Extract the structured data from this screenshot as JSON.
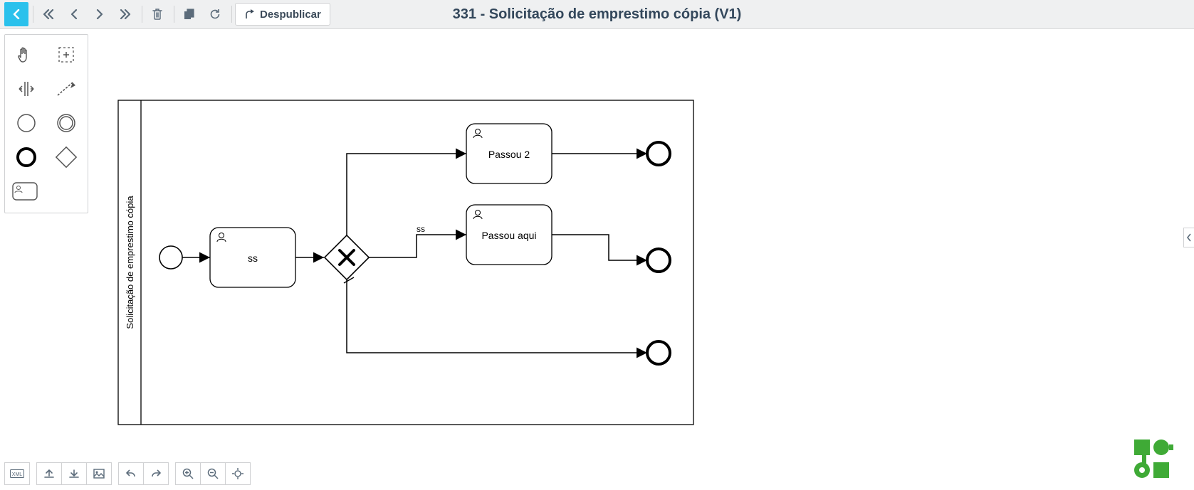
{
  "header": {
    "title": "331 - Solicitação de emprestimo cópia (V1)",
    "unpublish_label": "Despublicar"
  },
  "toolbar": {
    "back": {
      "name": "back-button"
    },
    "first": {
      "name": "first-button"
    },
    "prev": {
      "name": "prev-button"
    },
    "next": {
      "name": "next-button"
    },
    "last": {
      "name": "last-button"
    },
    "delete": {
      "name": "delete-button"
    },
    "copy": {
      "name": "copy-button"
    },
    "refresh": {
      "name": "refresh-button"
    },
    "unpublish": {
      "name": "unpublish-button"
    }
  },
  "palette": {
    "items": [
      {
        "name": "hand-tool-icon"
      },
      {
        "name": "lasso-tool-icon"
      },
      {
        "name": "space-tool-icon"
      },
      {
        "name": "connect-tool-icon"
      },
      {
        "name": "start-event-icon"
      },
      {
        "name": "intermediate-event-icon"
      },
      {
        "name": "end-event-icon"
      },
      {
        "name": "gateway-icon"
      },
      {
        "name": "user-task-icon"
      }
    ]
  },
  "diagram": {
    "pool_label": "Solicitação de emprestimo cópia",
    "tasks": [
      {
        "id": "task_ss",
        "label": "ss"
      },
      {
        "id": "task_passou2",
        "label": "Passou 2"
      },
      {
        "id": "task_passou_aqui",
        "label": "Passou aqui"
      }
    ],
    "sequence_flow_labels": {
      "sf_gateway_to_passou_aqui": "ss"
    }
  },
  "bottombar": {
    "items": [
      {
        "name": "xml-view-button"
      },
      {
        "name": "upload-button"
      },
      {
        "name": "download-button"
      },
      {
        "name": "image-export-button"
      },
      {
        "name": "undo-button"
      },
      {
        "name": "redo-button"
      },
      {
        "name": "zoom-in-button"
      },
      {
        "name": "zoom-out-button"
      },
      {
        "name": "zoom-fit-button"
      }
    ]
  }
}
